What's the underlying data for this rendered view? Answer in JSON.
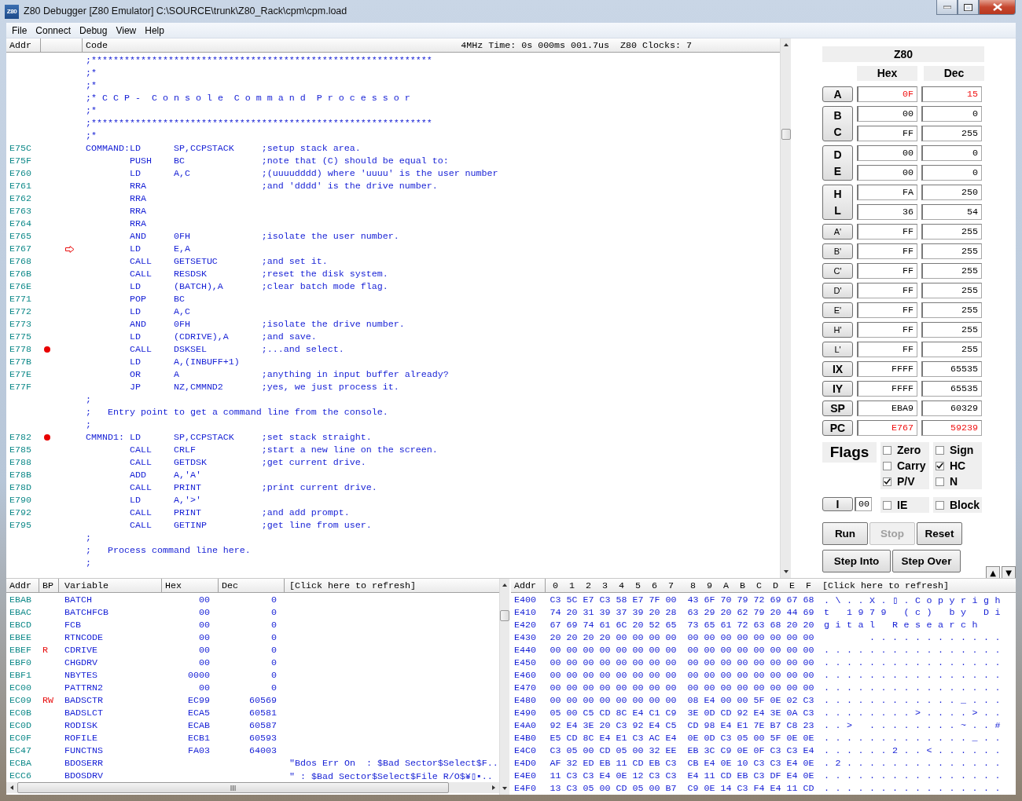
{
  "window": {
    "title": "Z80 Debugger [Z80 Emulator] C:\\SOURCE\\trunk\\Z80_Rack\\cpm\\cpm.load",
    "icon_text": "Z80"
  },
  "menu": [
    "File",
    "Connect",
    "Debug",
    "View",
    "Help"
  ],
  "code_view": {
    "columns": [
      "Addr",
      "Code"
    ],
    "timing": "4MHz Time: 0s 000ms 001.7us  Z80 Clocks: 7",
    "lines": [
      {
        "kind": "comment",
        "text": ";**************************************************************"
      },
      {
        "kind": "comment",
        "text": ";*"
      },
      {
        "kind": "comment",
        "text": ";*"
      },
      {
        "kind": "comment",
        "text": ";* C C P -  C o n s o l e  C o m m a n d  P r o c e s s o r"
      },
      {
        "kind": "comment",
        "text": ";*"
      },
      {
        "kind": "comment",
        "text": ";**************************************************************"
      },
      {
        "kind": "comment",
        "text": ";*"
      },
      {
        "kind": "instruction",
        "addr": "E75C",
        "breakpoint": false,
        "current": false,
        "label": "COMMAND:",
        "op": "LD",
        "operand": "SP,CCPSTACK",
        "comment": ";setup stack area."
      },
      {
        "kind": "instruction",
        "addr": "E75F",
        "breakpoint": false,
        "current": false,
        "op": "PUSH",
        "operand": "BC",
        "comment": ";note that (C) should be equal to:"
      },
      {
        "kind": "instruction",
        "addr": "E760",
        "breakpoint": false,
        "current": false,
        "op": "LD",
        "operand": "A,C",
        "comment": ";(uuuudddd) where 'uuuu' is the user number"
      },
      {
        "kind": "instruction",
        "addr": "E761",
        "breakpoint": false,
        "current": false,
        "op": "RRA",
        "comment": ";and 'dddd' is the drive number."
      },
      {
        "kind": "instruction",
        "addr": "E762",
        "breakpoint": false,
        "current": false,
        "op": "RRA"
      },
      {
        "kind": "instruction",
        "addr": "E763",
        "breakpoint": false,
        "current": false,
        "op": "RRA"
      },
      {
        "kind": "instruction",
        "addr": "E764",
        "breakpoint": false,
        "current": false,
        "op": "RRA"
      },
      {
        "kind": "instruction",
        "addr": "E765",
        "breakpoint": false,
        "current": false,
        "op": "AND",
        "operand": "0FH",
        "comment": ";isolate the user number."
      },
      {
        "kind": "instruction",
        "addr": "E767",
        "breakpoint": false,
        "current": true,
        "op": "LD",
        "operand": "E,A"
      },
      {
        "kind": "instruction",
        "addr": "E768",
        "breakpoint": false,
        "current": false,
        "op": "CALL",
        "operand": "GETSETUC",
        "comment": ";and set it."
      },
      {
        "kind": "instruction",
        "addr": "E76B",
        "breakpoint": false,
        "current": false,
        "op": "CALL",
        "operand": "RESDSK",
        "comment": ";reset the disk system."
      },
      {
        "kind": "instruction",
        "addr": "E76E",
        "breakpoint": false,
        "current": false,
        "op": "LD",
        "operand": "(BATCH),A",
        "comment": ";clear batch mode flag."
      },
      {
        "kind": "instruction",
        "addr": "E771",
        "breakpoint": false,
        "current": false,
        "op": "POP",
        "operand": "BC"
      },
      {
        "kind": "instruction",
        "addr": "E772",
        "breakpoint": false,
        "current": false,
        "op": "LD",
        "operand": "A,C"
      },
      {
        "kind": "instruction",
        "addr": "E773",
        "breakpoint": false,
        "current": false,
        "op": "AND",
        "operand": "0FH",
        "comment": ";isolate the drive number."
      },
      {
        "kind": "instruction",
        "addr": "E775",
        "breakpoint": false,
        "current": false,
        "op": "LD",
        "operand": "(CDRIVE),A",
        "comment": ";and save."
      },
      {
        "kind": "instruction",
        "addr": "E778",
        "breakpoint": true,
        "current": false,
        "op": "CALL",
        "operand": "DSKSEL",
        "comment": ";...and select."
      },
      {
        "kind": "instruction",
        "addr": "E77B",
        "breakpoint": false,
        "current": false,
        "op": "LD",
        "operand": "A,(INBUFF+1)"
      },
      {
        "kind": "instruction",
        "addr": "E77E",
        "breakpoint": false,
        "current": false,
        "op": "OR",
        "operand": "A",
        "comment": ";anything in input buffer already?"
      },
      {
        "kind": "instruction",
        "addr": "E77F",
        "breakpoint": false,
        "current": false,
        "op": "JP",
        "operand": "NZ,CMMND2",
        "comment": ";yes, we just process it."
      },
      {
        "kind": "comment",
        "text": ";"
      },
      {
        "kind": "comment",
        "text": ";   Entry point to get a command line from the console."
      },
      {
        "kind": "comment",
        "text": ";"
      },
      {
        "kind": "instruction",
        "addr": "E782",
        "breakpoint": true,
        "current": false,
        "label": "CMMND1:",
        "op": "LD",
        "operand": "SP,CCPSTACK",
        "comment": ";set stack straight."
      },
      {
        "kind": "instruction",
        "addr": "E785",
        "breakpoint": false,
        "current": false,
        "op": "CALL",
        "operand": "CRLF",
        "comment": ";start a new line on the screen."
      },
      {
        "kind": "instruction",
        "addr": "E788",
        "breakpoint": false,
        "current": false,
        "op": "CALL",
        "operand": "GETDSK",
        "comment": ";get current drive."
      },
      {
        "kind": "instruction",
        "addr": "E78B",
        "breakpoint": false,
        "current": false,
        "op": "ADD",
        "operand": "A,'A'"
      },
      {
        "kind": "instruction",
        "addr": "E78D",
        "breakpoint": false,
        "current": false,
        "op": "CALL",
        "operand": "PRINT",
        "comment": ";print current drive."
      },
      {
        "kind": "instruction",
        "addr": "E790",
        "breakpoint": false,
        "current": false,
        "op": "LD",
        "operand": "A,'>'"
      },
      {
        "kind": "instruction",
        "addr": "E792",
        "breakpoint": false,
        "current": false,
        "op": "CALL",
        "operand": "PRINT",
        "comment": ";and add prompt."
      },
      {
        "kind": "instruction",
        "addr": "E795",
        "breakpoint": false,
        "current": false,
        "op": "CALL",
        "operand": "GETINP",
        "comment": ";get line from user."
      },
      {
        "kind": "comment",
        "text": ";"
      },
      {
        "kind": "comment",
        "text": ";   Process command line here."
      },
      {
        "kind": "comment",
        "text": ";"
      }
    ]
  },
  "registers": {
    "title": "Z80",
    "columns": [
      "Hex",
      "Dec"
    ],
    "groups": [
      {
        "kind": "main",
        "regs": [
          {
            "name": "A",
            "hex": "0F",
            "dec": "15",
            "changed": true
          }
        ]
      },
      {
        "kind": "main",
        "regs": [
          {
            "name": "B",
            "hex": "00",
            "dec": "0",
            "changed": false
          },
          {
            "name": "C",
            "hex": "FF",
            "dec": "255",
            "changed": false
          }
        ]
      },
      {
        "kind": "main",
        "regs": [
          {
            "name": "D",
            "hex": "00",
            "dec": "0",
            "changed": false
          },
          {
            "name": "E",
            "hex": "00",
            "dec": "0",
            "changed": false
          }
        ]
      },
      {
        "kind": "main",
        "regs": [
          {
            "name": "H",
            "hex": "FA",
            "dec": "250",
            "changed": false
          },
          {
            "name": "L",
            "hex": "36",
            "dec": "54",
            "changed": false
          }
        ]
      },
      {
        "kind": "alternate",
        "regs": [
          {
            "name": "A'",
            "hex": "FF",
            "dec": "255",
            "changed": false
          }
        ]
      },
      {
        "kind": "alternate",
        "regs": [
          {
            "name": "B'",
            "hex": "FF",
            "dec": "255",
            "changed": false
          }
        ]
      },
      {
        "kind": "alternate",
        "regs": [
          {
            "name": "C'",
            "hex": "FF",
            "dec": "255",
            "changed": false
          }
        ]
      },
      {
        "kind": "alternate",
        "regs": [
          {
            "name": "D'",
            "hex": "FF",
            "dec": "255",
            "changed": false
          }
        ]
      },
      {
        "kind": "alternate",
        "regs": [
          {
            "name": "E'",
            "hex": "FF",
            "dec": "255",
            "changed": false
          }
        ]
      },
      {
        "kind": "alternate",
        "regs": [
          {
            "name": "H'",
            "hex": "FF",
            "dec": "255",
            "changed": false
          }
        ]
      },
      {
        "kind": "alternate",
        "regs": [
          {
            "name": "L'",
            "hex": "FF",
            "dec": "255",
            "changed": false
          }
        ]
      },
      {
        "kind": "main",
        "regs": [
          {
            "name": "IX",
            "hex": "FFFF",
            "dec": "65535",
            "changed": false
          }
        ]
      },
      {
        "kind": "main",
        "regs": [
          {
            "name": "IY",
            "hex": "FFFF",
            "dec": "65535",
            "changed": false
          }
        ]
      },
      {
        "kind": "main",
        "regs": [
          {
            "name": "SP",
            "hex": "EBA9",
            "dec": "60329",
            "changed": false
          }
        ]
      },
      {
        "kind": "main",
        "regs": [
          {
            "name": "PC",
            "hex": "E767",
            "dec": "59239",
            "changed": true
          }
        ]
      }
    ]
  },
  "flags": {
    "label": "Flags",
    "items": [
      {
        "name": "Zero",
        "checked": false
      },
      {
        "name": "Sign",
        "checked": false
      },
      {
        "name": "Carry",
        "checked": false
      },
      {
        "name": "HC",
        "checked": true
      },
      {
        "name": "P/V",
        "checked": true
      },
      {
        "name": "N",
        "checked": false
      }
    ]
  },
  "interrupt": {
    "register": "I",
    "value": "00",
    "items": [
      {
        "name": "IE",
        "checked": false
      },
      {
        "name": "Block",
        "checked": false
      }
    ]
  },
  "button_rows": [
    [
      {
        "label": "Run",
        "disabled": false
      },
      {
        "label": "Stop",
        "disabled": true
      },
      {
        "label": "Reset",
        "disabled": false
      }
    ],
    [
      {
        "label": "Step Into",
        "disabled": false
      },
      {
        "label": "Step Over",
        "disabled": false
      }
    ]
  ],
  "spin_buttons": [
    "▲",
    "▼"
  ],
  "variables": {
    "columns": [
      "Addr",
      "BP",
      "Variable",
      "Hex",
      "Dec",
      "[Click here to refresh]"
    ],
    "rows": [
      {
        "addr": "EBAB",
        "name": "BATCH",
        "hex": "00",
        "dec": "0"
      },
      {
        "addr": "EBAC",
        "name": "BATCHFCB",
        "hex": "00",
        "dec": "0"
      },
      {
        "addr": "EBCD",
        "name": "FCB",
        "hex": "00",
        "dec": "0"
      },
      {
        "addr": "EBEE",
        "name": "RTNCODE",
        "hex": "00",
        "dec": "0"
      },
      {
        "addr": "EBEF",
        "bp": "R",
        "name": "CDRIVE",
        "hex": "00",
        "dec": "0"
      },
      {
        "addr": "EBF0",
        "name": "CHGDRV",
        "hex": "00",
        "dec": "0"
      },
      {
        "addr": "EBF1",
        "name": "NBYTES",
        "hex": "0000",
        "dec": "0"
      },
      {
        "addr": "EC00",
        "name": "PATTRN2",
        "hex": "00",
        "dec": "0"
      },
      {
        "addr": "EC09",
        "bp": "RW",
        "name": "BADSCTR",
        "hex": "EC99",
        "dec": "60569"
      },
      {
        "addr": "EC0B",
        "name": "BADSLCT",
        "hex": "ECA5",
        "dec": "60581"
      },
      {
        "addr": "EC0D",
        "name": "RODISK",
        "hex": "ECAB",
        "dec": "60587"
      },
      {
        "addr": "EC0F",
        "name": "ROFILE",
        "hex": "ECB1",
        "dec": "60593"
      },
      {
        "addr": "EC47",
        "name": "FUNCTNS",
        "hex": "FA03",
        "dec": "64003"
      },
      {
        "addr": "ECBA",
        "name": "BDOSERR",
        "value": "\"Bdos Err On  : $Bad Sector$Select$F.."
      },
      {
        "addr": "ECC6",
        "name": "BDOSDRV",
        "value": "\" : $Bad Sector$Select$File R/O$¥▯▪.."
      }
    ]
  },
  "memory": {
    "columns": [
      "Addr",
      "0",
      "1",
      "2",
      "3",
      "4",
      "5",
      "6",
      "7",
      "8",
      "9",
      "A",
      "B",
      "C",
      "D",
      "E",
      "F",
      "[Click here to refresh]"
    ],
    "rows": [
      {
        "addr": "E400",
        "bytes": [
          "C3",
          "5C",
          "E7",
          "C3",
          "58",
          "E7",
          "7F",
          "00",
          "43",
          "6F",
          "70",
          "79",
          "72",
          "69",
          "67",
          "68"
        ],
        "ascii": ".\\..X.▯.Copyrigh"
      },
      {
        "addr": "E410",
        "bytes": [
          "74",
          "20",
          "31",
          "39",
          "37",
          "39",
          "20",
          "28",
          "63",
          "29",
          "20",
          "62",
          "79",
          "20",
          "44",
          "69"
        ],
        "ascii": "t 1979 (c) by Di"
      },
      {
        "addr": "E420",
        "bytes": [
          "67",
          "69",
          "74",
          "61",
          "6C",
          "20",
          "52",
          "65",
          "73",
          "65",
          "61",
          "72",
          "63",
          "68",
          "20",
          "20"
        ],
        "ascii": "gital Research  "
      },
      {
        "addr": "E430",
        "bytes": [
          "20",
          "20",
          "20",
          "20",
          "00",
          "00",
          "00",
          "00",
          "00",
          "00",
          "00",
          "00",
          "00",
          "00",
          "00",
          "00"
        ],
        "ascii": "    ............"
      },
      {
        "addr": "E440",
        "bytes": [
          "00",
          "00",
          "00",
          "00",
          "00",
          "00",
          "00",
          "00",
          "00",
          "00",
          "00",
          "00",
          "00",
          "00",
          "00",
          "00"
        ],
        "ascii": "................"
      },
      {
        "addr": "E450",
        "bytes": [
          "00",
          "00",
          "00",
          "00",
          "00",
          "00",
          "00",
          "00",
          "00",
          "00",
          "00",
          "00",
          "00",
          "00",
          "00",
          "00"
        ],
        "ascii": "................"
      },
      {
        "addr": "E460",
        "bytes": [
          "00",
          "00",
          "00",
          "00",
          "00",
          "00",
          "00",
          "00",
          "00",
          "00",
          "00",
          "00",
          "00",
          "00",
          "00",
          "00"
        ],
        "ascii": "................"
      },
      {
        "addr": "E470",
        "bytes": [
          "00",
          "00",
          "00",
          "00",
          "00",
          "00",
          "00",
          "00",
          "00",
          "00",
          "00",
          "00",
          "00",
          "00",
          "00",
          "00"
        ],
        "ascii": "................"
      },
      {
        "addr": "E480",
        "bytes": [
          "00",
          "00",
          "00",
          "00",
          "00",
          "00",
          "00",
          "00",
          "08",
          "E4",
          "00",
          "00",
          "5F",
          "0E",
          "02",
          "C3"
        ],
        "ascii": "............_..."
      },
      {
        "addr": "E490",
        "bytes": [
          "05",
          "00",
          "C5",
          "CD",
          "8C",
          "E4",
          "C1",
          "C9",
          "3E",
          "0D",
          "CD",
          "92",
          "E4",
          "3E",
          "0A",
          "C3"
        ],
        "ascii": "........>....>.."
      },
      {
        "addr": "E4A0",
        "bytes": [
          "92",
          "E4",
          "3E",
          "20",
          "C3",
          "92",
          "E4",
          "C5",
          "CD",
          "98",
          "E4",
          "E1",
          "7E",
          "B7",
          "C8",
          "23"
        ],
        "ascii": "..> ........~..#"
      },
      {
        "addr": "E4B0",
        "bytes": [
          "E5",
          "CD",
          "8C",
          "E4",
          "E1",
          "C3",
          "AC",
          "E4",
          "0E",
          "0D",
          "C3",
          "05",
          "00",
          "5F",
          "0E",
          "0E"
        ],
        "ascii": "............._.."
      },
      {
        "addr": "E4C0",
        "bytes": [
          "C3",
          "05",
          "00",
          "CD",
          "05",
          "00",
          "32",
          "EE",
          "EB",
          "3C",
          "C9",
          "0E",
          "0F",
          "C3",
          "C3",
          "E4"
        ],
        "ascii": "......2..<......"
      },
      {
        "addr": "E4D0",
        "bytes": [
          "AF",
          "32",
          "ED",
          "EB",
          "11",
          "CD",
          "EB",
          "C3",
          "CB",
          "E4",
          "0E",
          "10",
          "C3",
          "C3",
          "E4",
          "0E"
        ],
        "ascii": ".2.............."
      },
      {
        "addr": "E4E0",
        "bytes": [
          "11",
          "C3",
          "C3",
          "E4",
          "0E",
          "12",
          "C3",
          "C3",
          "E4",
          "11",
          "CD",
          "EB",
          "C3",
          "DF",
          "E4",
          "0E"
        ],
        "ascii": "................"
      },
      {
        "addr": "E4F0",
        "bytes": [
          "13",
          "C3",
          "05",
          "00",
          "CD",
          "05",
          "00",
          "B7",
          "C9",
          "0E",
          "14",
          "C3",
          "F4",
          "E4",
          "11",
          "CD"
        ],
        "ascii": "................"
      }
    ]
  }
}
